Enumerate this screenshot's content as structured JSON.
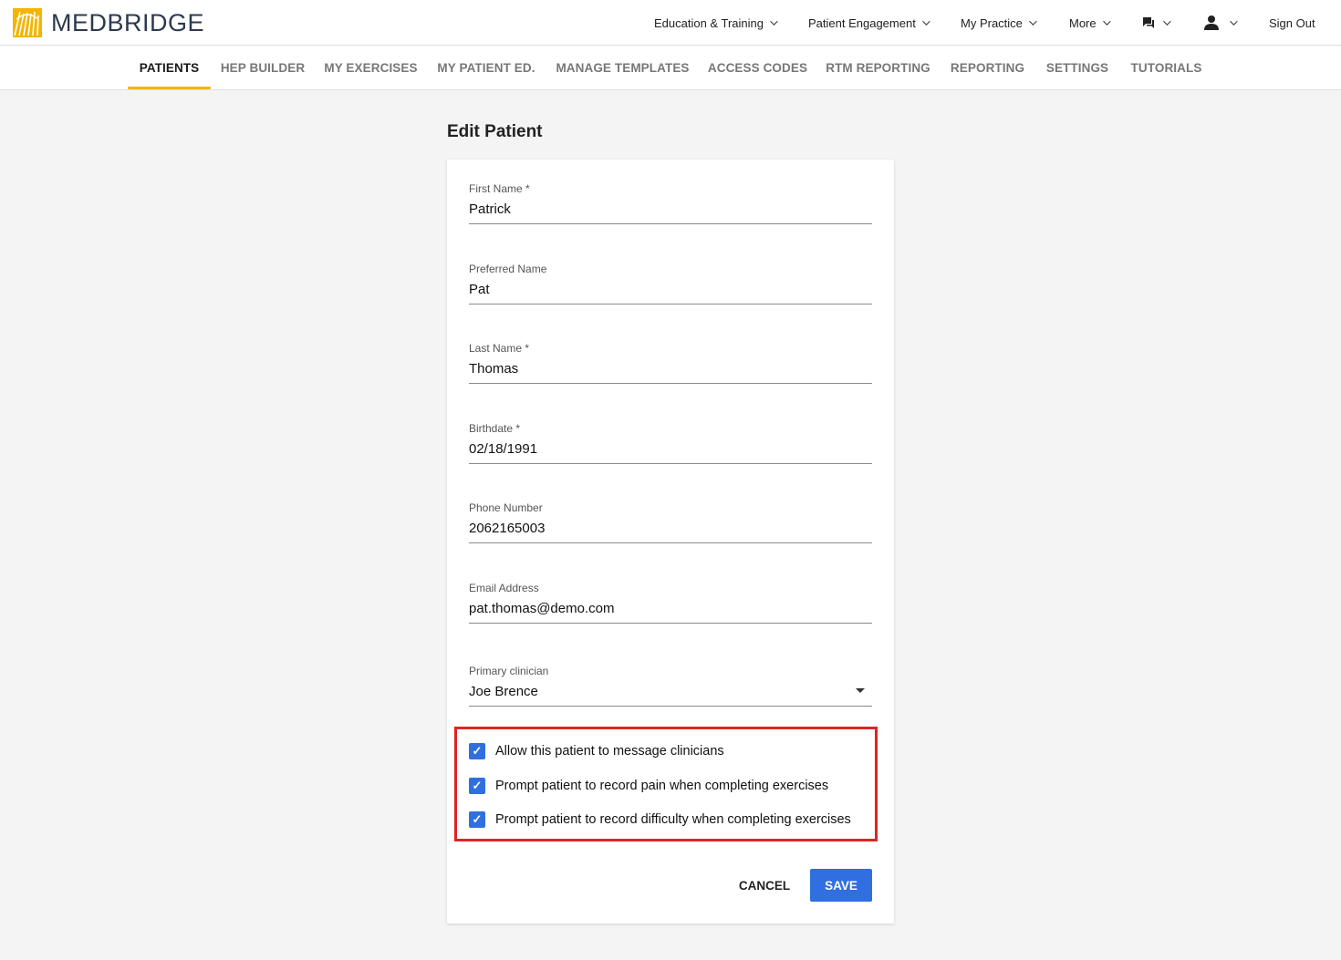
{
  "brand": {
    "name": "MEDBRIDGE",
    "accent": "#f4b400",
    "primary": "#2f6fe0"
  },
  "topnav": {
    "education": "Education & Training",
    "engagement": "Patient Engagement",
    "practice": "My Practice",
    "more": "More",
    "sign_out": "Sign Out",
    "messages_icon": "chat-icon",
    "user_icon": "person-icon"
  },
  "tabs": [
    "PATIENTS",
    "HEP BUILDER",
    "MY EXERCISES",
    "MY PATIENT ED.",
    "MANAGE TEMPLATES",
    "ACCESS CODES",
    "RTM REPORTING",
    "REPORTING",
    "SETTINGS",
    "TUTORIALS"
  ],
  "active_tab": "PATIENTS",
  "page": {
    "title": "Edit Patient"
  },
  "form": {
    "first_name": {
      "label": "First Name *",
      "value": "Patrick"
    },
    "preferred_name": {
      "label": "Preferred Name",
      "value": "Pat"
    },
    "last_name": {
      "label": "Last Name *",
      "value": "Thomas"
    },
    "birthdate": {
      "label": "Birthdate *",
      "value": "02/18/1991"
    },
    "phone": {
      "label": "Phone Number",
      "value": "2062165003"
    },
    "email": {
      "label": "Email Address",
      "value": "pat.thomas@demo.com"
    },
    "clinician": {
      "label": "Primary clinician",
      "value": "Joe Brence"
    }
  },
  "options": [
    {
      "label": "Allow this patient to message clinicians",
      "checked": true
    },
    {
      "label": "Prompt patient to record pain when completing exercises",
      "checked": true
    },
    {
      "label": "Prompt patient to record difficulty when completing exercises",
      "checked": true
    }
  ],
  "actions": {
    "cancel": "CANCEL",
    "save": "SAVE"
  }
}
